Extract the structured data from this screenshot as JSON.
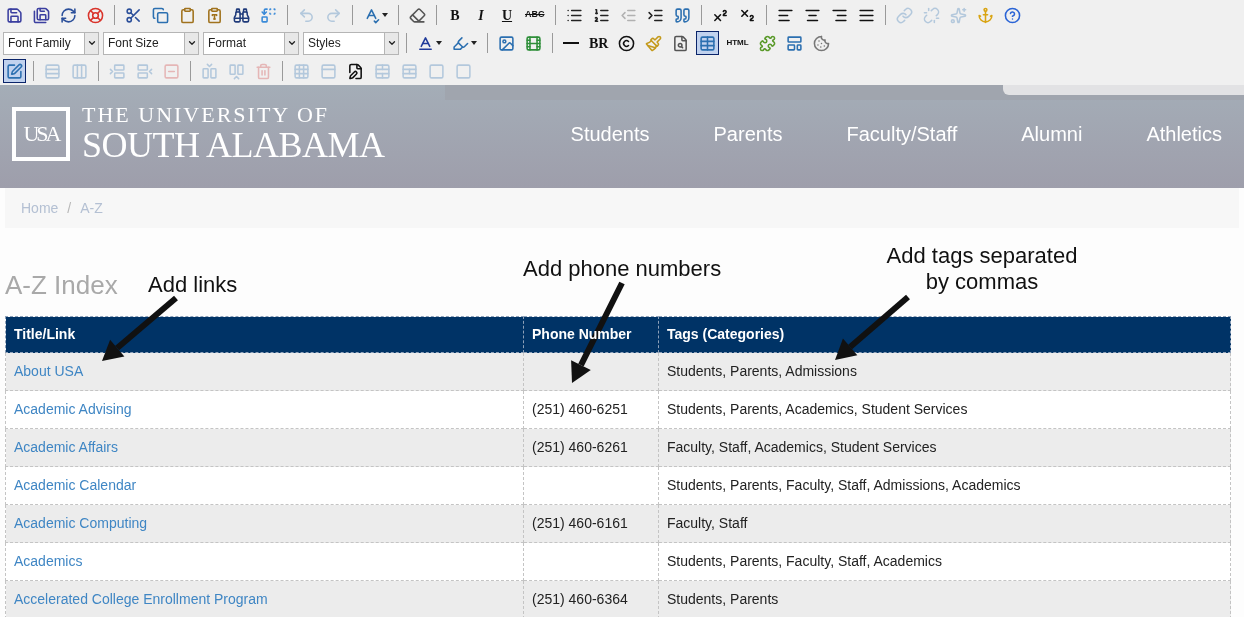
{
  "toolbar": {
    "rows": [
      {
        "items": [
          {
            "kind": "button",
            "disabled": false,
            "selected": false
          },
          {
            "kind": "button",
            "disabled": false,
            "selected": false
          },
          {
            "kind": "button",
            "disabled": false,
            "selected": false
          },
          {
            "kind": "button",
            "disabled": false,
            "selected": false
          },
          {
            "kind": "separator"
          },
          {
            "kind": "button",
            "disabled": false,
            "selected": false
          },
          {
            "kind": "button",
            "disabled": false,
            "selected": false
          },
          {
            "kind": "button",
            "disabled": false,
            "selected": false
          },
          {
            "kind": "button",
            "disabled": false,
            "selected": false
          },
          {
            "kind": "button",
            "disabled": false,
            "selected": false
          },
          {
            "kind": "button",
            "disabled": false,
            "selected": false
          },
          {
            "kind": "separator"
          },
          {
            "kind": "button",
            "disabled": true,
            "selected": false
          },
          {
            "kind": "button",
            "disabled": true,
            "selected": false
          },
          {
            "kind": "separator"
          },
          {
            "kind": "dropdown-button",
            "disabled": false,
            "selected": false
          },
          {
            "kind": "separator"
          },
          {
            "kind": "button",
            "disabled": false,
            "selected": false
          },
          {
            "kind": "separator"
          },
          {
            "kind": "text-button",
            "label": "B",
            "disabled": false,
            "selected": false
          },
          {
            "kind": "text-button",
            "label": "I",
            "disabled": false,
            "selected": false
          },
          {
            "kind": "text-button",
            "label": "U",
            "disabled": false,
            "selected": false
          },
          {
            "kind": "text-button",
            "label": "ABC",
            "disabled": false,
            "selected": false
          },
          {
            "kind": "separator"
          },
          {
            "kind": "button",
            "disabled": false,
            "selected": false
          },
          {
            "kind": "button",
            "disabled": false,
            "selected": false
          },
          {
            "kind": "button",
            "disabled": true,
            "selected": false
          },
          {
            "kind": "button",
            "disabled": false,
            "selected": false
          },
          {
            "kind": "button",
            "disabled": false,
            "selected": false
          },
          {
            "kind": "separator"
          },
          {
            "kind": "button",
            "disabled": false,
            "selected": false
          },
          {
            "kind": "button",
            "disabled": false,
            "selected": false
          },
          {
            "kind": "separator"
          },
          {
            "kind": "button",
            "disabled": false,
            "selected": false
          },
          {
            "kind": "button",
            "disabled": false,
            "selected": false
          },
          {
            "kind": "button",
            "disabled": false,
            "selected": false
          },
          {
            "kind": "button",
            "disabled": false,
            "selected": false
          },
          {
            "kind": "separator"
          },
          {
            "kind": "button",
            "disabled": true,
            "selected": false
          },
          {
            "kind": "button",
            "disabled": true,
            "selected": false
          },
          {
            "kind": "button",
            "disabled": true,
            "selected": false
          },
          {
            "kind": "button",
            "disabled": false,
            "selected": false
          },
          {
            "kind": "button",
            "disabled": false,
            "selected": false
          }
        ]
      },
      {
        "items": [
          {
            "kind": "select",
            "placeholder": "Font Family"
          },
          {
            "kind": "select",
            "placeholder": "Font Size"
          },
          {
            "kind": "select",
            "placeholder": "Format"
          },
          {
            "kind": "select",
            "placeholder": "Styles"
          },
          {
            "kind": "separator"
          },
          {
            "kind": "dropdown-button",
            "disabled": false,
            "selected": false
          },
          {
            "kind": "dropdown-button",
            "disabled": false,
            "selected": false
          },
          {
            "kind": "separator"
          },
          {
            "kind": "button",
            "disabled": false,
            "selected": false
          },
          {
            "kind": "button",
            "disabled": false,
            "selected": false
          },
          {
            "kind": "separator"
          },
          {
            "kind": "button",
            "disabled": false,
            "selected": false
          },
          {
            "kind": "text-button",
            "label": "BR",
            "disabled": false,
            "selected": false
          },
          {
            "kind": "button",
            "disabled": false,
            "selected": false
          },
          {
            "kind": "button",
            "disabled": false,
            "selected": false
          },
          {
            "kind": "button",
            "disabled": false,
            "selected": false
          },
          {
            "kind": "button",
            "disabled": false,
            "selected": true
          },
          {
            "kind": "text-button",
            "label": "HTML",
            "disabled": false,
            "selected": false
          },
          {
            "kind": "button",
            "disabled": false,
            "selected": false
          },
          {
            "kind": "button",
            "disabled": false,
            "selected": false
          },
          {
            "kind": "button",
            "disabled": false,
            "selected": false
          }
        ]
      },
      {
        "items": [
          {
            "kind": "button",
            "disabled": false,
            "selected": true
          },
          {
            "kind": "separator"
          },
          {
            "kind": "button",
            "disabled": true,
            "selected": false
          },
          {
            "kind": "button",
            "disabled": true,
            "selected": false
          },
          {
            "kind": "separator"
          },
          {
            "kind": "button",
            "disabled": true,
            "selected": false
          },
          {
            "kind": "button",
            "disabled": true,
            "selected": false
          },
          {
            "kind": "button",
            "disabled": true,
            "selected": false
          },
          {
            "kind": "separator"
          },
          {
            "kind": "button",
            "disabled": true,
            "selected": false
          },
          {
            "kind": "button",
            "disabled": true,
            "selected": false
          },
          {
            "kind": "button",
            "disabled": true,
            "selected": false
          },
          {
            "kind": "separator"
          },
          {
            "kind": "button",
            "disabled": true,
            "selected": false
          },
          {
            "kind": "button",
            "disabled": true,
            "selected": false
          },
          {
            "kind": "button",
            "disabled": false,
            "selected": false
          },
          {
            "kind": "button",
            "disabled": true,
            "selected": false
          },
          {
            "kind": "button",
            "disabled": true,
            "selected": false
          },
          {
            "kind": "button",
            "disabled": true,
            "selected": false
          },
          {
            "kind": "button",
            "disabled": true,
            "selected": false
          }
        ]
      }
    ]
  },
  "header": {
    "logo_monogram": "USA",
    "name_line_1": "THE UNIVERSITY OF",
    "name_line_2": "SOUTH ALABAMA",
    "nav": [
      "Students",
      "Parents",
      "Faculty/Staff",
      "Alumni",
      "Athletics"
    ]
  },
  "breadcrumb": [
    "Home",
    "A-Z"
  ],
  "breadcrumb_separator": "/",
  "heading": "A-Z Index",
  "annotations": [
    {
      "text": "Add links"
    },
    {
      "text": "Add phone numbers"
    },
    {
      "text": "Add tags separated by commas"
    }
  ],
  "table": {
    "columns": [
      "Title/Link",
      "Phone Number",
      "Tags (Categories)"
    ],
    "rows": [
      {
        "title": "About USA",
        "phone": "",
        "tags": "Students, Parents, Admissions"
      },
      {
        "title": "Academic Advising",
        "phone": "(251) 460-6251",
        "tags": "Students, Parents, Academics, Student Services"
      },
      {
        "title": "Academic Affairs",
        "phone": "(251) 460-6261",
        "tags": "Faculty, Staff, Academics, Student Services"
      },
      {
        "title": "Academic Calendar",
        "phone": "",
        "tags": "Students, Parents, Faculty, Staff, Admissions, Academics"
      },
      {
        "title": "Academic Computing",
        "phone": "(251) 460-6161",
        "tags": "Faculty, Staff"
      },
      {
        "title": "Academics",
        "phone": "",
        "tags": "Students, Parents, Faculty, Staff, Academics"
      },
      {
        "title": "Accelerated College Enrollment Program",
        "phone": "(251) 460-6364",
        "tags": "Students, Parents"
      }
    ]
  }
}
